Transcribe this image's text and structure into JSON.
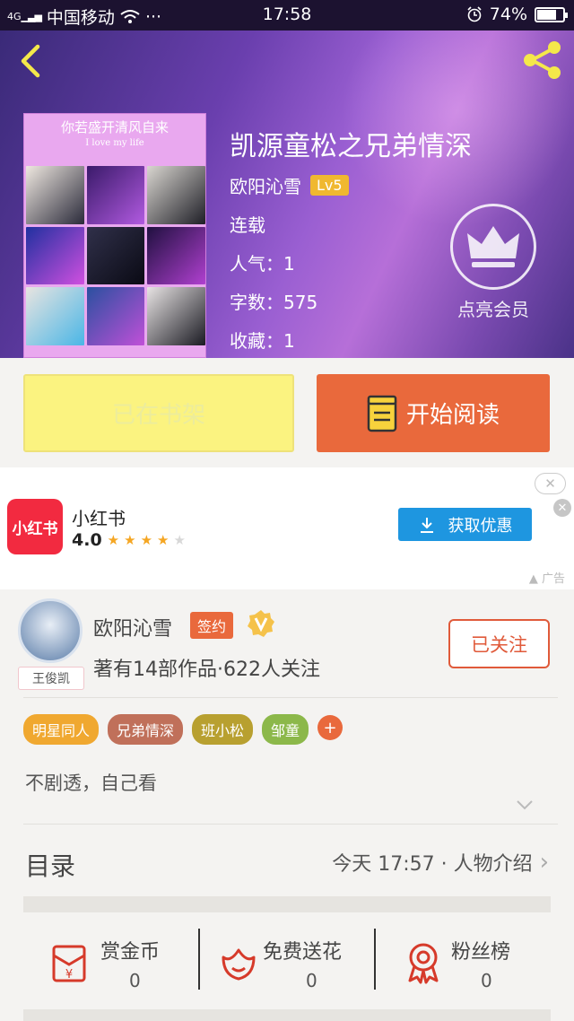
{
  "status_bar": {
    "carrier": "中国移动",
    "signal_label": "4G",
    "dots": "···",
    "time": "17:58",
    "battery_percent": "74%",
    "battery_level": 0.74
  },
  "book": {
    "title": "凯源童松之兄弟情深",
    "author": "欧阳沁雪",
    "level": "Lv5",
    "status": "连载",
    "popularity": "人气：1",
    "word_count": "字数：575",
    "favorites": "收藏：1",
    "cover_title": "你若盛开清风自来",
    "cover_subtitle": "I love my life"
  },
  "vip": {
    "label": "点亮会员"
  },
  "actions": {
    "shelf_label": "已在书架",
    "read_label": "开始阅读"
  },
  "ad": {
    "app_logo_text": "小红书",
    "app_name": "小红书",
    "rating": "4.0",
    "rating_value": 4,
    "cta_label": "获取优惠",
    "ad_tag": "广告",
    "close_symbol": "✕"
  },
  "author": {
    "name": "欧阳沁雪",
    "signed_badge": "签约",
    "stats": "著有14部作品·622人关注",
    "follow_label": "已关注",
    "avatar_tag": "王俊凯"
  },
  "tags": [
    {
      "label": "明星同人",
      "color": "#f0a830"
    },
    {
      "label": "兄弟情深",
      "color": "#c0705a"
    },
    {
      "label": "班小松",
      "color": "#b8a030"
    },
    {
      "label": "邹童",
      "color": "#8cb84a"
    }
  ],
  "tag_more": "+",
  "description": "不剧透，自己看",
  "toc": {
    "label": "目录",
    "latest": "今天 17:57 · 人物介绍"
  },
  "bottom": [
    {
      "label": "赏金币",
      "value": "0",
      "icon": "reward-coin-icon"
    },
    {
      "label": "免费送花",
      "value": "0",
      "icon": "flower-icon"
    },
    {
      "label": "粉丝榜",
      "value": "0",
      "icon": "medal-icon"
    }
  ],
  "colors": {
    "accent": "#e9693c",
    "shelf_button": "#fbf380",
    "ad_button": "#1e96e0",
    "icon_red": "#d63a2a"
  }
}
